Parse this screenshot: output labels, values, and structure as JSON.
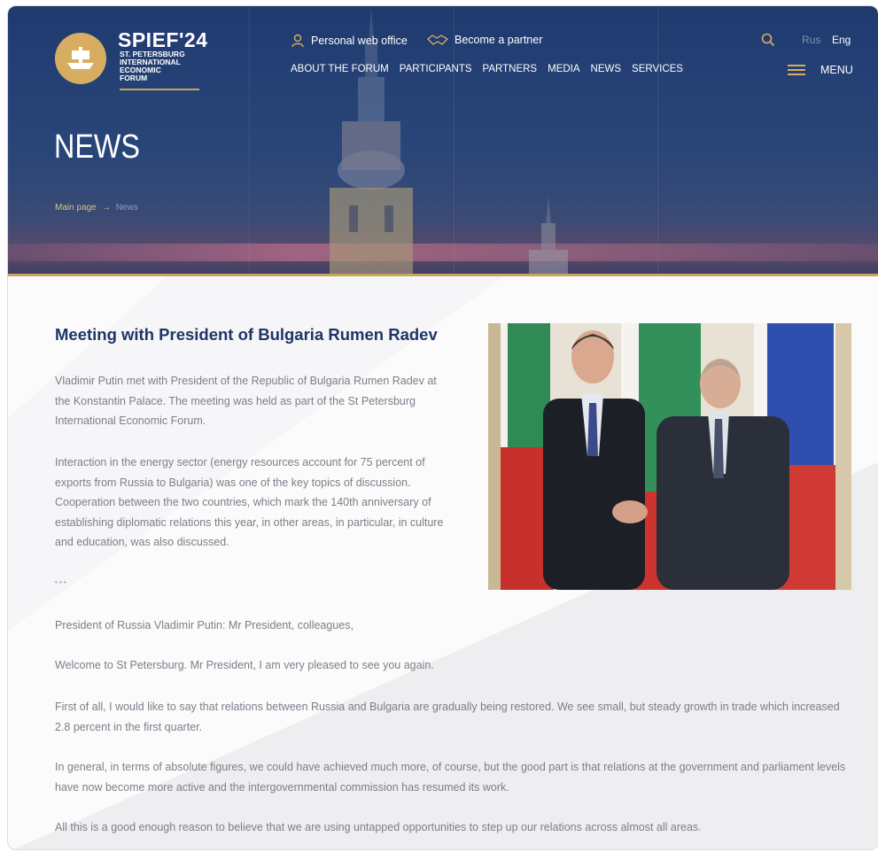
{
  "header": {
    "logo_title": "SPIEF'24",
    "logo_sub": [
      "ST. PETERSBURG",
      "INTERNATIONAL",
      "ECONOMIC",
      "FORUM"
    ],
    "personal_office": "Personal web office",
    "become_partner": "Become a partner",
    "nav": [
      "ABOUT THE FORUM",
      "PARTICIPANTS",
      "PARTNERS",
      "MEDIA",
      "NEWS",
      "SERVICES"
    ],
    "lang_rus": "Rus",
    "lang_eng": "Eng",
    "menu": "MENU"
  },
  "hero": {
    "title": "NEWS",
    "breadcrumb": {
      "home": "Main page",
      "separator": "→",
      "current": "News"
    }
  },
  "article": {
    "title": "Meeting with President of Bulgaria Rumen Radev",
    "paragraphs": [
      "Vladimir Putin met with President of the Republic of Bulgaria Rumen Radev at the Konstantin Palace. The meeting was held as part of the St Petersburg International Economic Forum.",
      "Interaction in the energy sector (energy resources account for 75 percent of exports from Russia to Bulgaria) was one of the key topics of discussion. Cooperation between the two countries, which mark the 140th anniversary of establishing diplomatic relations this year, in other areas, in particular, in culture and education, was also discussed.",
      "• • •",
      "President of Russia Vladimir Putin: Mr President, colleagues,",
      "Welcome to St Petersburg. Mr President, I am very pleased to see you again.",
      "First of all, I would like to say that relations between Russia and Bulgaria are gradually being restored. We see small, but steady growth in trade which increased 2.8 percent in the first quarter.",
      "In general, in terms of absolute figures, we could have achieved much more, of course, but the good part is that relations at the government and parliament levels have now become more active and the intergovernmental commission has resumed its work.",
      "All this is a good enough reason to believe that we are using untapped opportunities to step up our relations across almost all areas."
    ]
  },
  "colors": {
    "header_bg": "#1f3a6f",
    "gold": "#c9a45a",
    "title_navy": "#1e3566",
    "body_text": "#7a7f88"
  },
  "icons": [
    "person-icon",
    "handshake-icon",
    "search-icon",
    "hamburger-icon",
    "logo-emblem"
  ]
}
